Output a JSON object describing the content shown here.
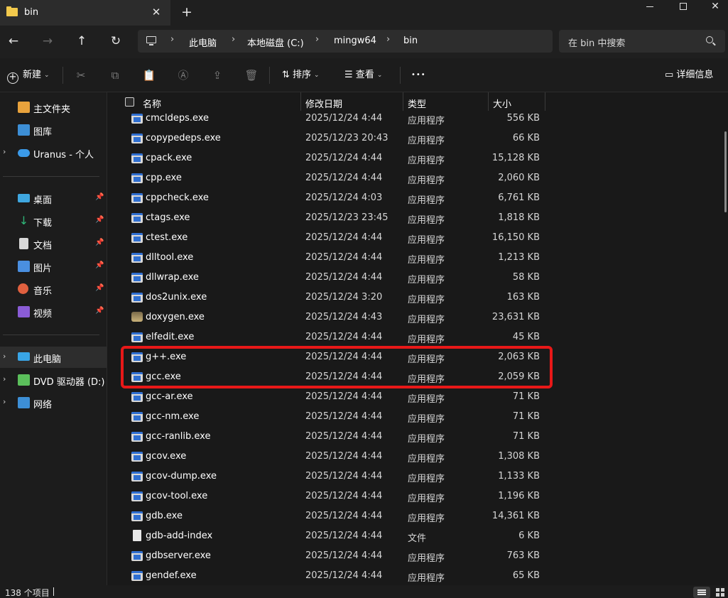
{
  "window": {
    "tab_title": "bin",
    "tab_close": "✕",
    "new_tab": "+",
    "close_glyph": "✕"
  },
  "nav": {
    "back": "←",
    "forward": "→",
    "up": "↑",
    "refresh": "↻",
    "sep": "›",
    "breadcrumbs": [
      "此电脑",
      "本地磁盘 (C:)",
      "mingw64",
      "bin"
    ],
    "search_placeholder": "在 bin 中搜索"
  },
  "toolbar": {
    "new_label": "新建",
    "sort_label": "排序",
    "view_label": "查看",
    "more": "•••",
    "details_label": "详细信息",
    "icons": [
      "cut-icon",
      "copy-icon",
      "paste-icon",
      "rename-icon",
      "share-icon",
      "delete-icon"
    ],
    "icon_glyphs": [
      "✂",
      "⧉",
      "📋",
      "Ⓐ",
      "⇪",
      "🗑"
    ]
  },
  "sidebar": {
    "items": [
      {
        "label": "主文件夹",
        "icon": "home-icon",
        "color": "#e8a23c"
      },
      {
        "label": "图库",
        "icon": "gallery-icon",
        "color": "#3d8fd6"
      },
      {
        "label": "Uranus - 个人",
        "icon": "cloud-icon",
        "color": "#3b9ae8",
        "chevron": "›"
      },
      {
        "label": "桌面",
        "icon": "desktop-icon",
        "color": "#3fa7e0",
        "pinned": "📌"
      },
      {
        "label": "下载",
        "icon": "download-icon",
        "color": "#2fb879",
        "pinned": "📌"
      },
      {
        "label": "文档",
        "icon": "documents-icon",
        "color": "#d9d9d9",
        "pinned": "📌"
      },
      {
        "label": "图片",
        "icon": "pictures-icon",
        "color": "#4a8fe0",
        "pinned": "📌"
      },
      {
        "label": "音乐",
        "icon": "music-icon",
        "color": "#e0603f",
        "pinned": "📌"
      },
      {
        "label": "视频",
        "icon": "videos-icon",
        "color": "#8a5cd6",
        "pinned": "📌"
      },
      {
        "label": "此电脑",
        "icon": "this-pc-icon",
        "color": "#39a5e6",
        "chevron": "›"
      },
      {
        "label": "DVD 驱动器 (D:) E",
        "icon": "dvd-icon",
        "color": "#5bbf5b",
        "chevron": "›"
      },
      {
        "label": "网络",
        "icon": "network-icon",
        "color": "#3d8fd6",
        "chevron": "›"
      }
    ]
  },
  "list": {
    "columns": [
      "名称",
      "修改日期",
      "类型",
      "大小"
    ],
    "sort_glyph": "^",
    "rows": [
      {
        "name": "cmcldeps.exe",
        "date": "2025/12/24 4:44",
        "type": "应用程序",
        "size": "556 KB"
      },
      {
        "name": "copypedeps.exe",
        "date": "2025/12/23 20:43",
        "type": "应用程序",
        "size": "66 KB"
      },
      {
        "name": "cpack.exe",
        "date": "2025/12/24 4:44",
        "type": "应用程序",
        "size": "15,128 KB"
      },
      {
        "name": "cpp.exe",
        "date": "2025/12/24 4:44",
        "type": "应用程序",
        "size": "2,060 KB"
      },
      {
        "name": "cppcheck.exe",
        "date": "2025/12/24 4:03",
        "type": "应用程序",
        "size": "6,761 KB"
      },
      {
        "name": "ctags.exe",
        "date": "2025/12/23 23:45",
        "type": "应用程序",
        "size": "1,818 KB"
      },
      {
        "name": "ctest.exe",
        "date": "2025/12/24 4:44",
        "type": "应用程序",
        "size": "16,150 KB"
      },
      {
        "name": "dlltool.exe",
        "date": "2025/12/24 4:44",
        "type": "应用程序",
        "size": "1,213 KB"
      },
      {
        "name": "dllwrap.exe",
        "date": "2025/12/24 4:44",
        "type": "应用程序",
        "size": "58 KB"
      },
      {
        "name": "dos2unix.exe",
        "date": "2025/12/24 3:20",
        "type": "应用程序",
        "size": "163 KB"
      },
      {
        "name": "doxygen.exe",
        "date": "2025/12/24 4:43",
        "type": "应用程序",
        "size": "23,631 KB",
        "icon": "doxygen"
      },
      {
        "name": "elfedit.exe",
        "date": "2025/12/24 4:44",
        "type": "应用程序",
        "size": "45 KB"
      },
      {
        "name": "g++.exe",
        "date": "2025/12/24 4:44",
        "type": "应用程序",
        "size": "2,063 KB"
      },
      {
        "name": "gcc.exe",
        "date": "2025/12/24 4:44",
        "type": "应用程序",
        "size": "2,059 KB"
      },
      {
        "name": "gcc-ar.exe",
        "date": "2025/12/24 4:44",
        "type": "应用程序",
        "size": "71 KB"
      },
      {
        "name": "gcc-nm.exe",
        "date": "2025/12/24 4:44",
        "type": "应用程序",
        "size": "71 KB"
      },
      {
        "name": "gcc-ranlib.exe",
        "date": "2025/12/24 4:44",
        "type": "应用程序",
        "size": "71 KB"
      },
      {
        "name": "gcov.exe",
        "date": "2025/12/24 4:44",
        "type": "应用程序",
        "size": "1,308 KB"
      },
      {
        "name": "gcov-dump.exe",
        "date": "2025/12/24 4:44",
        "type": "应用程序",
        "size": "1,133 KB"
      },
      {
        "name": "gcov-tool.exe",
        "date": "2025/12/24 4:44",
        "type": "应用程序",
        "size": "1,196 KB"
      },
      {
        "name": "gdb.exe",
        "date": "2025/12/24 4:44",
        "type": "应用程序",
        "size": "14,361 KB"
      },
      {
        "name": "gdb-add-index",
        "date": "2025/12/24 4:44",
        "type": "文件",
        "size": "6 KB",
        "icon": "doc"
      },
      {
        "name": "gdbserver.exe",
        "date": "2025/12/24 4:44",
        "type": "应用程序",
        "size": "763 KB"
      },
      {
        "name": "gendef.exe",
        "date": "2025/12/24 4:44",
        "type": "应用程序",
        "size": "65 KB"
      }
    ]
  },
  "status": {
    "item_count": "138 个项目"
  },
  "accent": {
    "highlight": "#e81818"
  }
}
